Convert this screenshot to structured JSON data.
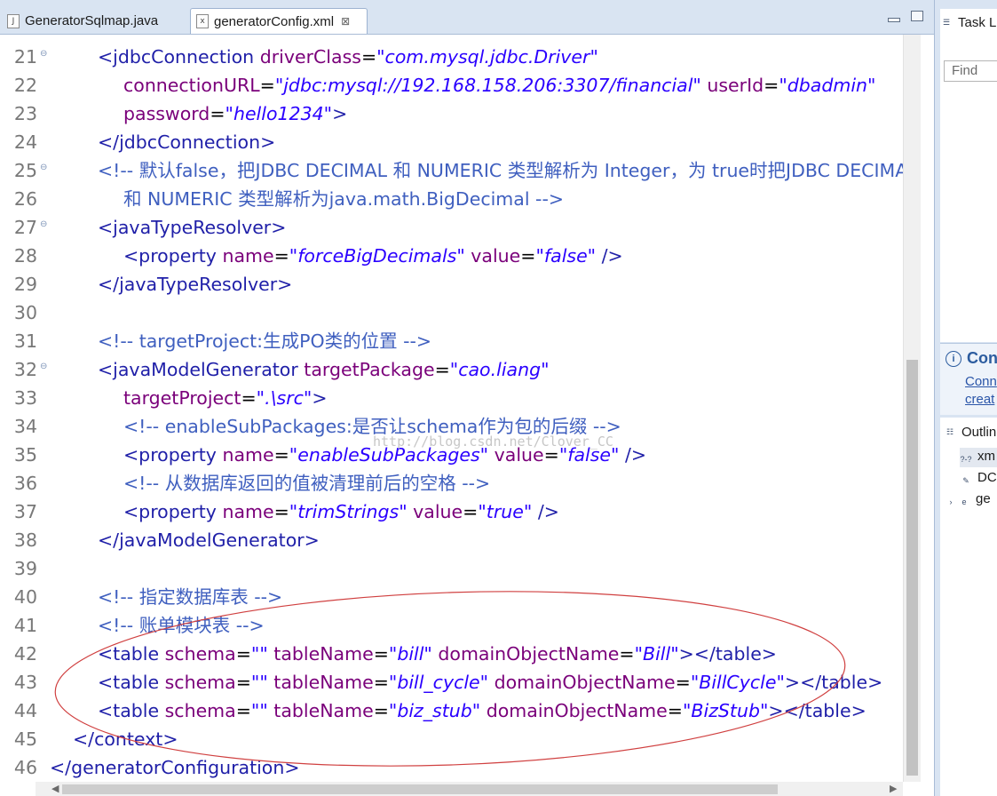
{
  "tabs": [
    {
      "label": "GeneratorSqlmap.java",
      "icon": "java-file-icon"
    },
    {
      "label": "generatorConfig.xml",
      "icon": "xml-file-icon",
      "close": "⊠"
    }
  ],
  "editor": {
    "watermark": "http://blog.csdn.net/Clover_CC",
    "lines": [
      {
        "no": "21",
        "fold": "⊖",
        "indent": 1,
        "segs": [
          [
            "tag",
            "<jdbcConnection "
          ],
          [
            "attr",
            "driverClass"
          ],
          [
            "txt",
            "="
          ],
          [
            "val",
            "\"com.mysql.jdbc.Driver\""
          ]
        ]
      },
      {
        "no": "22",
        "indent": 2,
        "segs": [
          [
            "attr",
            "connectionURL"
          ],
          [
            "txt",
            "="
          ],
          [
            "val",
            "\"jdbc:mysql://192.168.158.206:3307/financial\""
          ],
          [
            "txt",
            " "
          ],
          [
            "attr",
            "userId"
          ],
          [
            "txt",
            "="
          ],
          [
            "val",
            "\"dbadmin\""
          ]
        ]
      },
      {
        "no": "23",
        "indent": 2,
        "segs": [
          [
            "attr",
            "password"
          ],
          [
            "txt",
            "="
          ],
          [
            "val",
            "\"hello1234\""
          ],
          [
            "tag",
            ">"
          ]
        ]
      },
      {
        "no": "24",
        "indent": 1,
        "segs": [
          [
            "tag",
            "</jdbcConnection>"
          ]
        ]
      },
      {
        "no": "25",
        "fold": "⊖",
        "indent": 1,
        "segs": [
          [
            "cmt",
            "<!-- 默认false，把JDBC DECIMAL 和 NUMERIC 类型解析为 Integer，为 true时把JDBC DECIMAL"
          ]
        ]
      },
      {
        "no": "26",
        "indent": 2,
        "segs": [
          [
            "cmt",
            "和 NUMERIC 类型解析为java.math.BigDecimal -->"
          ]
        ]
      },
      {
        "no": "27",
        "fold": "⊖",
        "indent": 1,
        "segs": [
          [
            "tag",
            "<javaTypeResolver>"
          ]
        ]
      },
      {
        "no": "28",
        "indent": 2,
        "segs": [
          [
            "tag",
            "<property "
          ],
          [
            "attr",
            "name"
          ],
          [
            "txt",
            "="
          ],
          [
            "val",
            "\"forceBigDecimals\""
          ],
          [
            "txt",
            " "
          ],
          [
            "attr",
            "value"
          ],
          [
            "txt",
            "="
          ],
          [
            "val",
            "\"false\""
          ],
          [
            "tag",
            " />"
          ]
        ]
      },
      {
        "no": "29",
        "indent": 1,
        "segs": [
          [
            "tag",
            "</javaTypeResolver>"
          ]
        ]
      },
      {
        "no": "30",
        "indent": 0,
        "segs": []
      },
      {
        "no": "31",
        "indent": 1,
        "segs": [
          [
            "cmt",
            "<!-- targetProject:生成PO类的位置 -->"
          ]
        ]
      },
      {
        "no": "32",
        "fold": "⊖",
        "indent": 1,
        "segs": [
          [
            "tag",
            "<javaModelGenerator "
          ],
          [
            "attr",
            "targetPackage"
          ],
          [
            "txt",
            "="
          ],
          [
            "val",
            "\"cao.liang\""
          ]
        ]
      },
      {
        "no": "33",
        "indent": 2,
        "segs": [
          [
            "attr",
            "targetProject"
          ],
          [
            "txt",
            "="
          ],
          [
            "val",
            "\".\\src\""
          ],
          [
            "tag",
            ">"
          ]
        ]
      },
      {
        "no": "34",
        "indent": 2,
        "segs": [
          [
            "cmt",
            "<!-- enableSubPackages:是否让schema作为包的后缀 -->"
          ]
        ]
      },
      {
        "no": "35",
        "indent": 2,
        "segs": [
          [
            "tag",
            "<property "
          ],
          [
            "attr",
            "name"
          ],
          [
            "txt",
            "="
          ],
          [
            "val",
            "\"enableSubPackages\""
          ],
          [
            "txt",
            " "
          ],
          [
            "attr",
            "value"
          ],
          [
            "txt",
            "="
          ],
          [
            "val",
            "\"false\""
          ],
          [
            "tag",
            " />"
          ]
        ]
      },
      {
        "no": "36",
        "indent": 2,
        "segs": [
          [
            "cmt",
            "<!-- 从数据库返回的值被清理前后的空格 -->"
          ]
        ]
      },
      {
        "no": "37",
        "indent": 2,
        "segs": [
          [
            "tag",
            "<property "
          ],
          [
            "attr",
            "name"
          ],
          [
            "txt",
            "="
          ],
          [
            "val",
            "\"trimStrings\""
          ],
          [
            "txt",
            " "
          ],
          [
            "attr",
            "value"
          ],
          [
            "txt",
            "="
          ],
          [
            "val",
            "\"true\""
          ],
          [
            "tag",
            " />"
          ]
        ]
      },
      {
        "no": "38",
        "indent": 1,
        "segs": [
          [
            "tag",
            "</javaModelGenerator>"
          ]
        ]
      },
      {
        "no": "39",
        "indent": 0,
        "segs": []
      },
      {
        "no": "40",
        "indent": 1,
        "segs": [
          [
            "cmt",
            "<!-- 指定数据库表 -->"
          ]
        ]
      },
      {
        "no": "41",
        "indent": 1,
        "segs": [
          [
            "cmt",
            "<!-- 账单模块表 -->"
          ]
        ]
      },
      {
        "no": "42",
        "indent": 1,
        "segs": [
          [
            "tag",
            "<table "
          ],
          [
            "attr",
            "schema"
          ],
          [
            "txt",
            "="
          ],
          [
            "val",
            "\"\""
          ],
          [
            "txt",
            " "
          ],
          [
            "attr",
            "tableName"
          ],
          [
            "txt",
            "="
          ],
          [
            "val",
            "\"bill\""
          ],
          [
            "txt",
            " "
          ],
          [
            "attr",
            "domainObjectName"
          ],
          [
            "txt",
            "="
          ],
          [
            "val",
            "\"Bill\""
          ],
          [
            "tag",
            "></table>"
          ]
        ]
      },
      {
        "no": "43",
        "indent": 1,
        "segs": [
          [
            "tag",
            "<table "
          ],
          [
            "attr",
            "schema"
          ],
          [
            "txt",
            "="
          ],
          [
            "val",
            "\"\""
          ],
          [
            "txt",
            " "
          ],
          [
            "attr",
            "tableName"
          ],
          [
            "txt",
            "="
          ],
          [
            "val",
            "\"bill_cycle\""
          ],
          [
            "txt",
            " "
          ],
          [
            "attr",
            "domainObjectName"
          ],
          [
            "txt",
            "="
          ],
          [
            "val",
            "\"BillCycle\""
          ],
          [
            "tag",
            "></table>"
          ]
        ]
      },
      {
        "no": "44",
        "indent": 1,
        "segs": [
          [
            "tag",
            "<table "
          ],
          [
            "attr",
            "schema"
          ],
          [
            "txt",
            "="
          ],
          [
            "val",
            "\"\""
          ],
          [
            "txt",
            " "
          ],
          [
            "attr",
            "tableName"
          ],
          [
            "txt",
            "="
          ],
          [
            "val",
            "\"biz_stub\""
          ],
          [
            "txt",
            " "
          ],
          [
            "attr",
            "domainObjectName"
          ],
          [
            "txt",
            "="
          ],
          [
            "val",
            "\"BizStub\""
          ],
          [
            "tag",
            "></table>"
          ]
        ]
      },
      {
        "no": "45",
        "indent": 0.5,
        "segs": [
          [
            "tag",
            "</context>"
          ]
        ]
      },
      {
        "no": "46",
        "indent": 0,
        "segs": [
          [
            "tag",
            "</generatorConfiguration>"
          ]
        ]
      }
    ]
  },
  "colors": {
    "tag": "#1f1fa8",
    "attribute": "#7a007a",
    "value": "#2a00ff",
    "comment": "#3f5fbf",
    "annotation_ellipse": "#d04040"
  },
  "right_panel": {
    "task_list_title": "Task L",
    "find_placeholder": "Find",
    "connect_title": "Conn",
    "connect_link1": "Conn",
    "connect_link2": "creat",
    "outline_title": "Outlin",
    "outline_items": [
      {
        "label": "xm",
        "icon": "xml-pi-icon"
      },
      {
        "label": "DC",
        "icon": "doctype-icon"
      },
      {
        "label": "ge",
        "icon": "element-icon"
      }
    ]
  }
}
